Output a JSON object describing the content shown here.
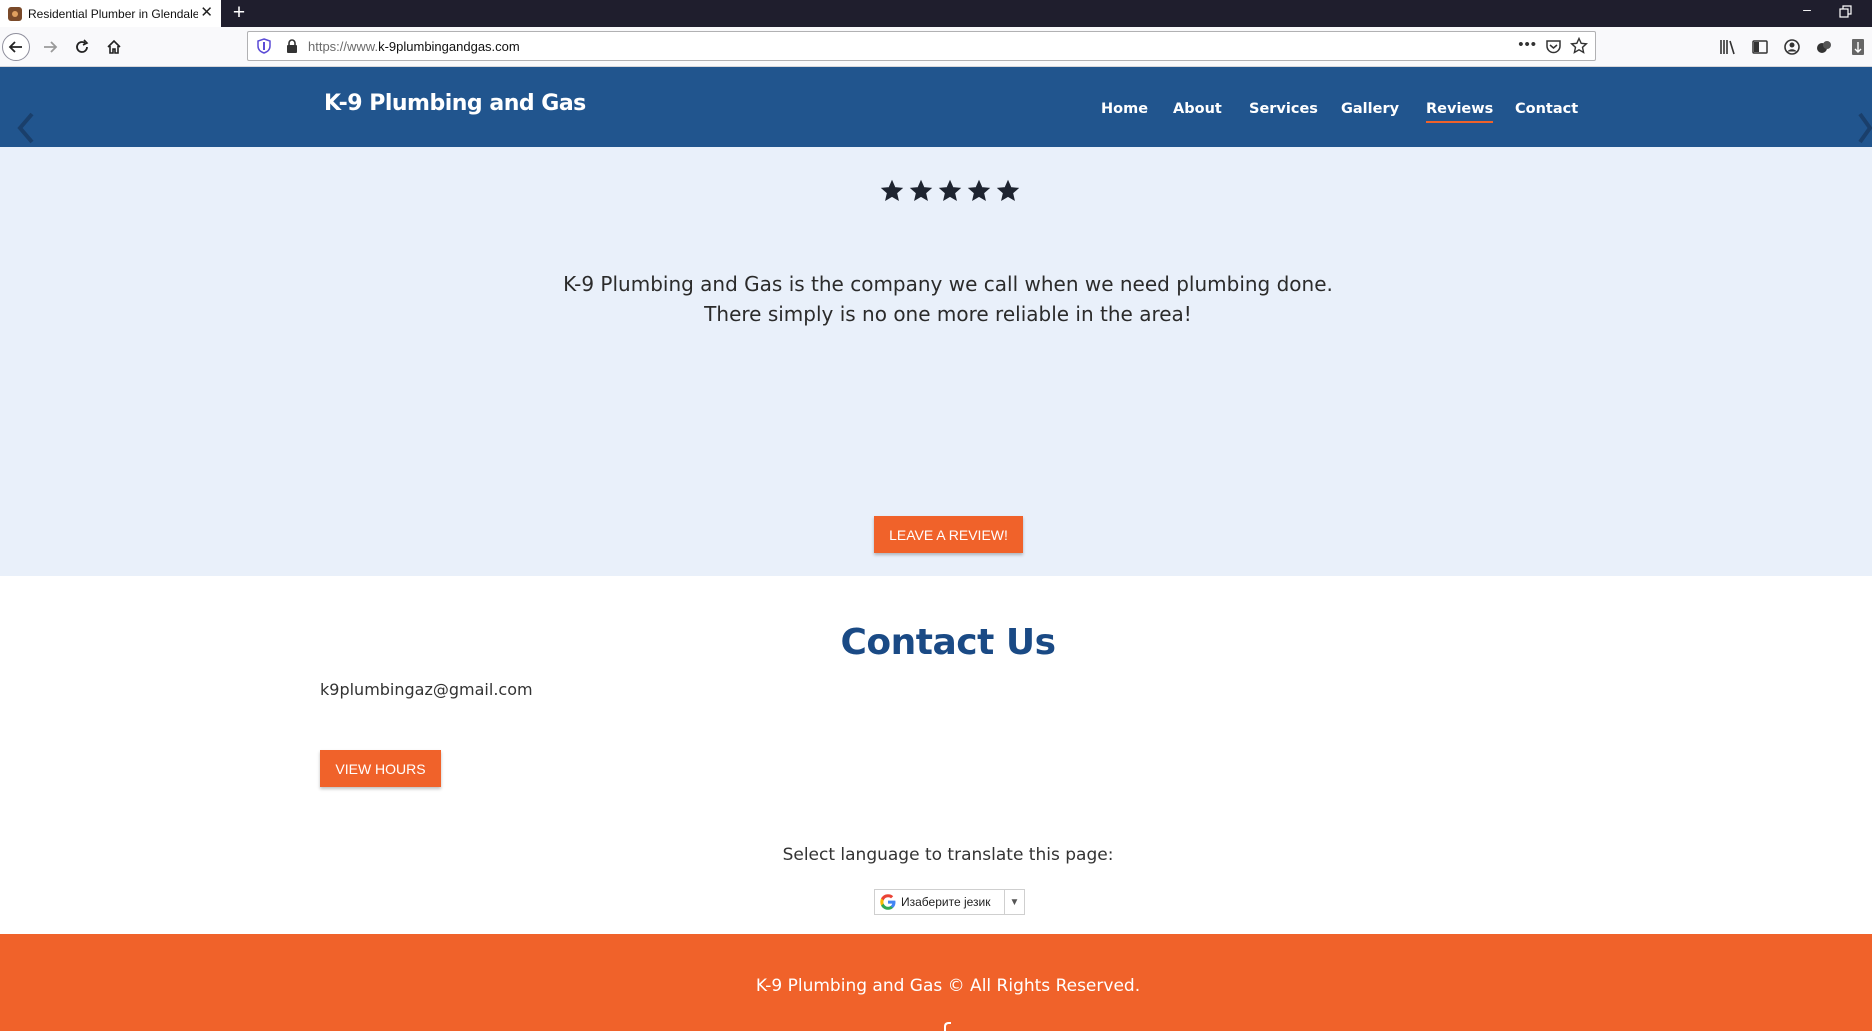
{
  "browser": {
    "tab_title": "Residential Plumber in Glendale",
    "url_prefix": "https://www.",
    "url_domain": "k-9plumbingandgas.com",
    "window_minimize": "–"
  },
  "site": {
    "logo": "K-9 Plumbing and Gas",
    "nav": {
      "home": "Home",
      "about": "About",
      "services": "Services",
      "gallery": "Gallery",
      "reviews": "Reviews",
      "contact": "Contact"
    },
    "active_nav": "Reviews"
  },
  "reviews": {
    "rating": 5,
    "rating_max": 5,
    "text": "K-9 Plumbing and Gas is the company we call when we need plumbing done. There simply is no one more reliable in the area!",
    "cta": "LEAVE A REVIEW!"
  },
  "contact": {
    "title": "Contact Us",
    "email": "k9plumbingaz@gmail.com",
    "hours_button": "VIEW HOURS",
    "translate_label": "Select language to translate this page:",
    "translate_select_value": "Изаберите језик",
    "translate_select_arrow": "▼"
  },
  "footer": {
    "copyright": "K-9 Plumbing and Gas © All Rights Reserved."
  },
  "colors": {
    "header_blue": "#21558e",
    "accent_orange": "#f0622a",
    "reviews_bg": "#e9f0fa",
    "title_blue": "#1a4a85"
  },
  "icons": [
    "back-icon",
    "forward-icon",
    "reload-icon",
    "home-icon",
    "shield-icon",
    "lock-icon",
    "more-icon",
    "pocket-icon",
    "bookmark-star-icon",
    "library-icon",
    "sidebar-icon",
    "account-icon",
    "extension-icon",
    "menu-icon",
    "star-icon",
    "google-icon",
    "facebook-icon",
    "chevron-left-icon",
    "chevron-right-icon"
  ]
}
